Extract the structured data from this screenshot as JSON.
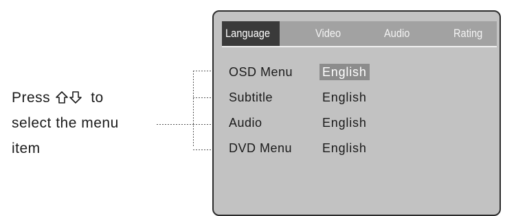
{
  "instruction": {
    "line1_prefix": "Press",
    "line1_suffix": "to",
    "line2": "select the menu",
    "line3": "item",
    "icons": [
      "up-arrow-icon",
      "down-arrow-icon"
    ]
  },
  "osd": {
    "tabs": [
      {
        "label": "Language",
        "active": true
      },
      {
        "label": "Video",
        "active": false
      },
      {
        "label": "Audio",
        "active": false
      },
      {
        "label": "Rating",
        "active": false
      }
    ],
    "items": [
      {
        "label": "OSD Menu",
        "value": "English",
        "selected": true
      },
      {
        "label": "Subtitle",
        "value": "English",
        "selected": false
      },
      {
        "label": "Audio",
        "value": "English",
        "selected": false
      },
      {
        "label": "DVD Menu",
        "value": "English",
        "selected": false
      }
    ]
  },
  "colors": {
    "panel_bg": "#c2c2c2",
    "tab_bar_bg": "#a2a2a2",
    "active_tab_bg": "#3a3a3a",
    "selected_value_bg": "#8c8c8c"
  }
}
